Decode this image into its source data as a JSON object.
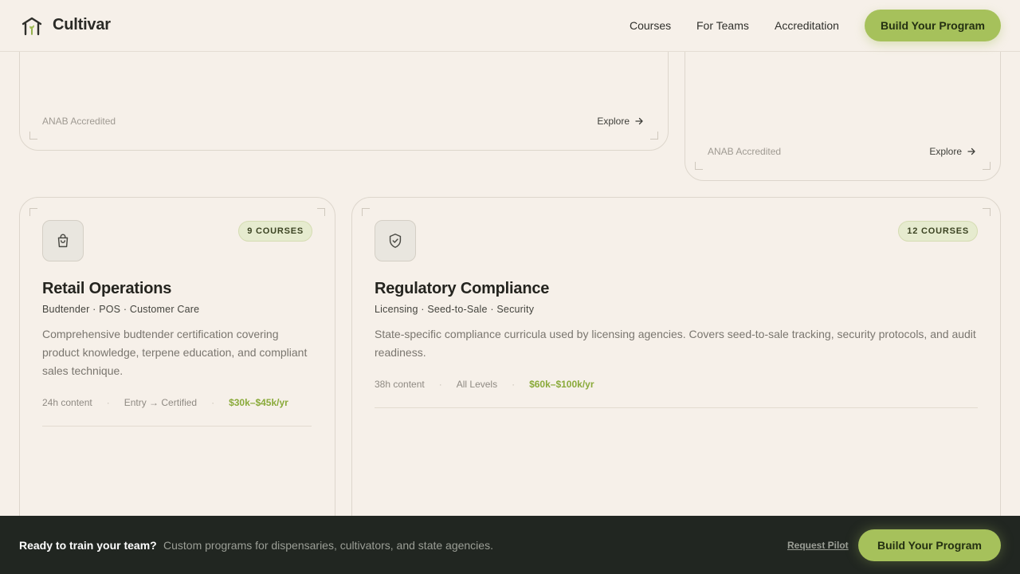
{
  "header": {
    "brand": "Cultivar",
    "logo_icon": "greenhouse-sprout-icon",
    "nav": [
      "Courses",
      "For Teams",
      "Accreditation"
    ],
    "cta": "Build Your Program"
  },
  "top_cards": [
    {
      "accreditation": "ANAB Accredited",
      "explore": "Explore"
    },
    {
      "accreditation": "ANAB Accredited",
      "explore": "Explore"
    }
  ],
  "cards": [
    {
      "icon": "shopping-bag-icon",
      "badge": "9 COURSES",
      "title": "Retail Operations",
      "tags": "Budtender · POS · Customer Care",
      "description": "Comprehensive budtender certification covering product knowledge, terpene education, and compliant sales technique.",
      "content": "24h content",
      "level": "Entry → Certified",
      "salary": "$30k–$45k/yr"
    },
    {
      "icon": "shield-check-icon",
      "badge": "12 COURSES",
      "title": "Regulatory Compliance",
      "tags": "Licensing · Seed-to-Sale · Security",
      "description": "State-specific compliance curricula used by licensing agencies. Covers seed-to-sale tracking, security protocols, and audit readiness.",
      "content": "38h content",
      "level": "All Levels",
      "salary": "$60k–$100k/yr"
    }
  ],
  "bottom_bar": {
    "title": "Ready to train your team?",
    "subtitle": "Custom programs for dispensaries, cultivators, and state agencies.",
    "pilot": "Request Pilot",
    "cta": "Build Your Program"
  },
  "colors": {
    "background": "#f6f0e9",
    "accent": "#a6c15b",
    "salary": "#8aaa3a",
    "bottom_bar": "#212621"
  }
}
